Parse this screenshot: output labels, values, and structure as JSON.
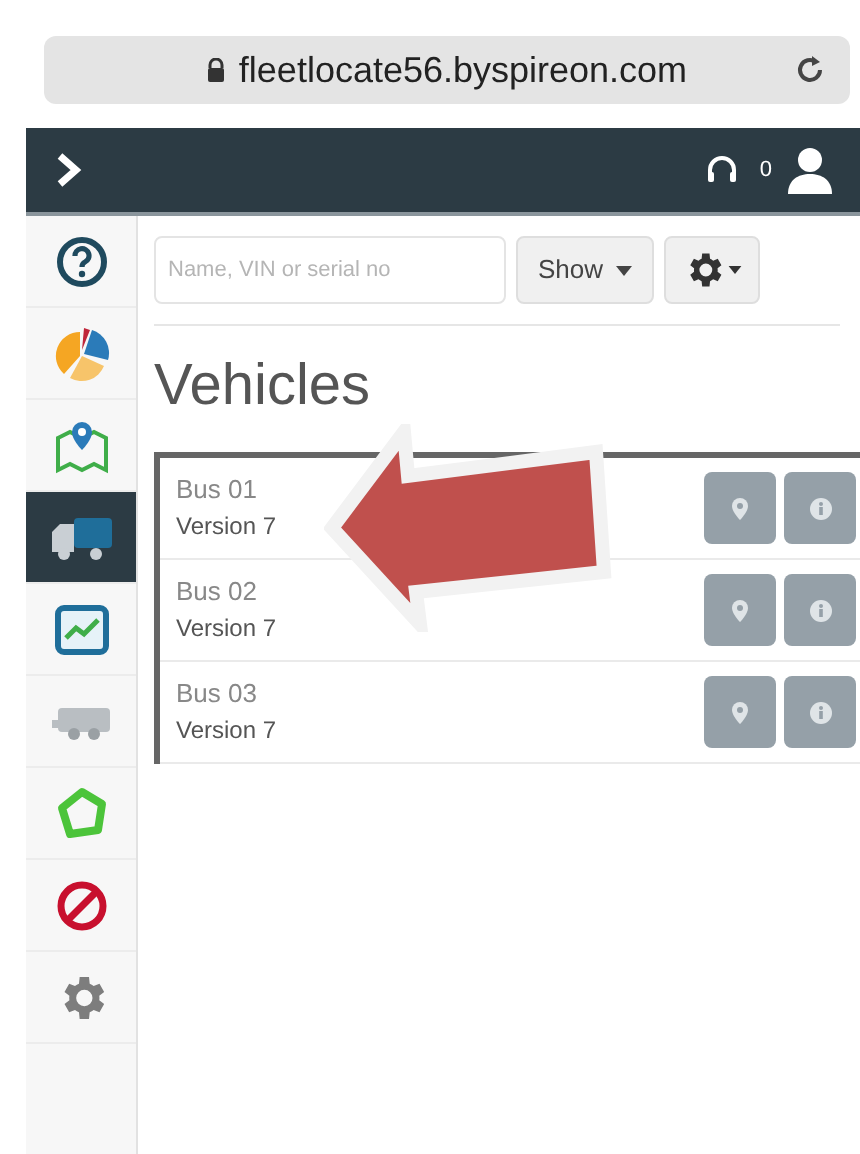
{
  "browser": {
    "url": "fleetlocate56.byspireon.com"
  },
  "navbar": {
    "notification_count": "0"
  },
  "sidebar": {
    "items": [
      {
        "selected": false
      },
      {
        "selected": false
      },
      {
        "selected": false
      },
      {
        "selected": true
      },
      {
        "selected": false
      },
      {
        "selected": false
      },
      {
        "selected": false
      },
      {
        "selected": false
      },
      {
        "selected": false
      }
    ]
  },
  "toolbar": {
    "search": {
      "placeholder": "Name, VIN or serial no"
    },
    "show_button": "Show"
  },
  "title": "Vehicles",
  "vehicles": [
    {
      "name": "Bus 01",
      "version": "Version 7"
    },
    {
      "name": "Bus 02",
      "version": "Version 7"
    },
    {
      "name": "Bus 03",
      "version": "Version 7"
    }
  ]
}
